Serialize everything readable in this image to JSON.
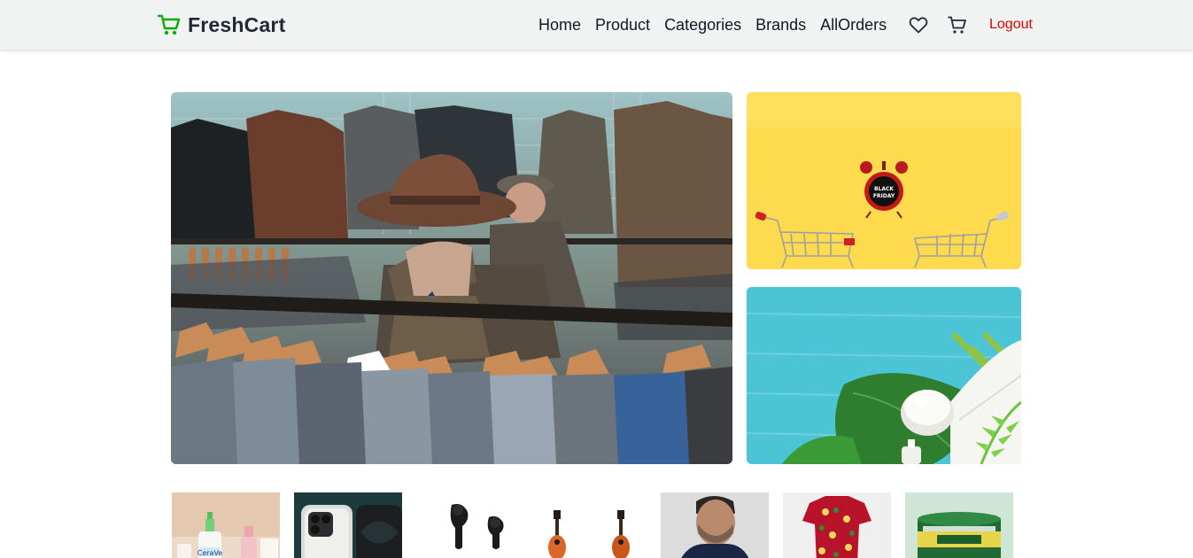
{
  "navbar": {
    "brand": "FreshCart",
    "links": [
      "Home",
      "Product",
      "Categories",
      "Brands",
      "AllOrders"
    ],
    "logout": "Logout",
    "icons": [
      "cart-logo-icon",
      "heart-icon",
      "cart-icon"
    ]
  },
  "hero": {
    "main_image": "clothing-rack-shopper",
    "top_image": "black-friday-alarm-carts",
    "top_image_badge": [
      "BLACK",
      "FRIDAY"
    ],
    "bottom_image": "skincare-leaves-towel"
  },
  "categories": [
    {
      "image": "skincare-bottles",
      "badge": "CeraVe"
    },
    {
      "image": "iphone"
    },
    {
      "image": "earbuds"
    },
    {
      "image": "guitars"
    },
    {
      "image": "man-portrait"
    },
    {
      "image": "floral-shirt"
    },
    {
      "image": "grocery-can"
    }
  ],
  "colors": {
    "brand_green": "#0aad0a",
    "logout_red": "#e00000",
    "navbar_bg": "#f0f3f2"
  }
}
